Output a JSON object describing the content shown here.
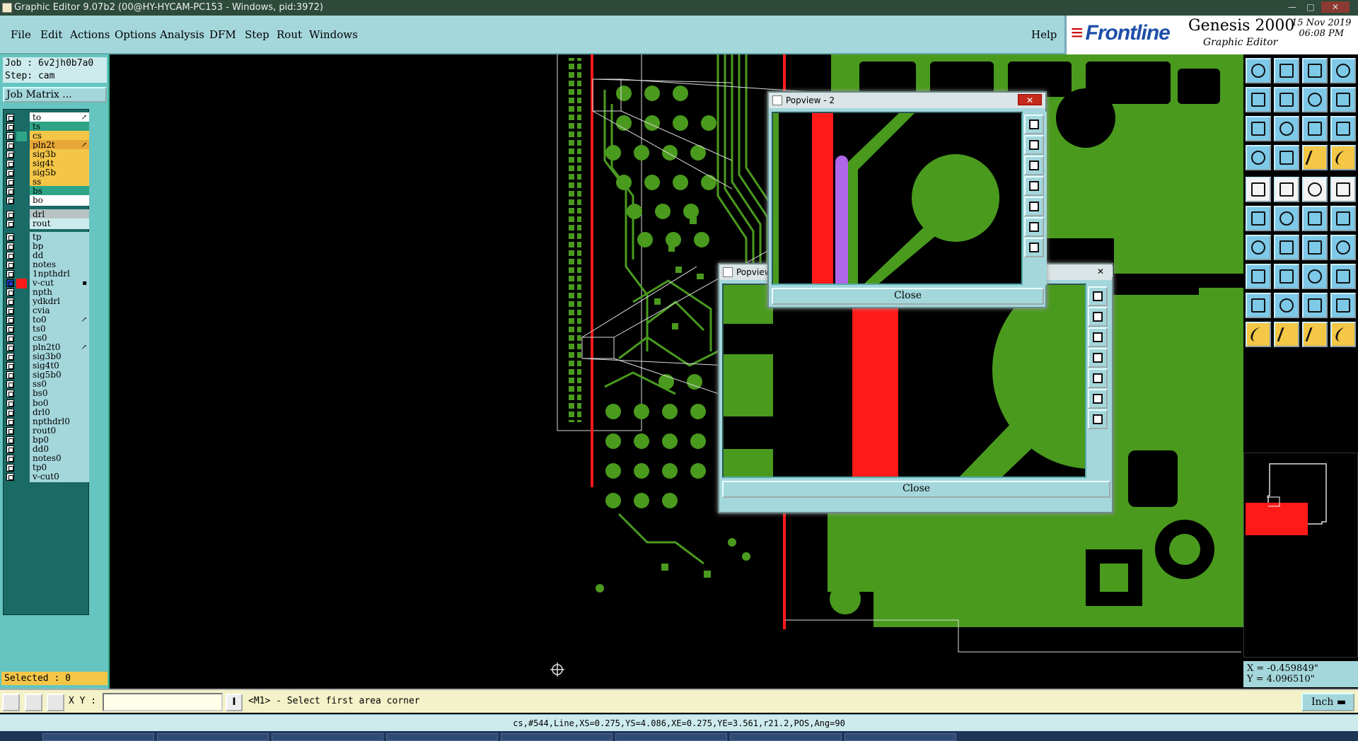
{
  "window": {
    "title": "Graphic Editor 9.07b2 (00@HY-HYCAM-PC153 - Windows, pid:3972)"
  },
  "menu": {
    "items": [
      "File",
      "Edit",
      "Actions",
      "Options",
      "Analysis",
      "DFM",
      "Step",
      "Rout",
      "Windows"
    ],
    "help": "Help"
  },
  "brand": {
    "logo": "Frontline",
    "product": "Genesis 2000",
    "subtitle": "Graphic Editor",
    "date": "15 Nov 2019",
    "time": "06:08 PM"
  },
  "job": {
    "job_line": "Job : 6v2jh0b7a0",
    "step_line": "Step: cam",
    "matrix_button": "Job Matrix ..."
  },
  "layers": [
    {
      "name": "to",
      "color": "#ffffff",
      "mark": "↗"
    },
    {
      "name": "ts",
      "color": "#2ea586",
      "mark": ""
    },
    {
      "name": "cs",
      "color": "#f4c648",
      "mark": ""
    },
    {
      "name": "pln2t",
      "color": "#e8a838",
      "mark": "↗"
    },
    {
      "name": "sig3b",
      "color": "#f4c648",
      "mark": ""
    },
    {
      "name": "sig4t",
      "color": "#f4c648",
      "mark": ""
    },
    {
      "name": "sig5b",
      "color": "#f4c648",
      "mark": ""
    },
    {
      "name": "ss",
      "color": "#f4c648",
      "mark": ""
    },
    {
      "name": "bs",
      "color": "#2ea586",
      "mark": ""
    },
    {
      "name": "bo",
      "color": "#ffffff",
      "mark": ""
    },
    {
      "name": "drl",
      "color": "#b7c4c4",
      "mark": ""
    },
    {
      "name": "rout",
      "color": "#cdebed",
      "mark": ""
    },
    {
      "name": "tp",
      "color": "#a4d7dc",
      "mark": ""
    },
    {
      "name": "bp",
      "color": "#a4d7dc",
      "mark": ""
    },
    {
      "name": "dd",
      "color": "#a4d7dc",
      "mark": ""
    },
    {
      "name": "notes",
      "color": "#a4d7dc",
      "mark": ""
    },
    {
      "name": "1npthdrl",
      "color": "#a4d7dc",
      "mark": ""
    },
    {
      "name": "v-cut",
      "color": "#a4d7dc",
      "mark": "▪"
    },
    {
      "name": "npth",
      "color": "#a4d7dc",
      "mark": ""
    },
    {
      "name": "ydkdrl",
      "color": "#a4d7dc",
      "mark": ""
    },
    {
      "name": "cvia",
      "color": "#a4d7dc",
      "mark": ""
    },
    {
      "name": "to0",
      "color": "#a4d7dc",
      "mark": "↗"
    },
    {
      "name": "ts0",
      "color": "#a4d7dc",
      "mark": ""
    },
    {
      "name": "cs0",
      "color": "#a4d7dc",
      "mark": ""
    },
    {
      "name": "pln2t0",
      "color": "#a4d7dc",
      "mark": "↗"
    },
    {
      "name": "sig3b0",
      "color": "#a4d7dc",
      "mark": ""
    },
    {
      "name": "sig4t0",
      "color": "#a4d7dc",
      "mark": ""
    },
    {
      "name": "sig5b0",
      "color": "#a4d7dc",
      "mark": ""
    },
    {
      "name": "ss0",
      "color": "#a4d7dc",
      "mark": ""
    },
    {
      "name": "bs0",
      "color": "#a4d7dc",
      "mark": ""
    },
    {
      "name": "bo0",
      "color": "#a4d7dc",
      "mark": ""
    },
    {
      "name": "drl0",
      "color": "#a4d7dc",
      "mark": ""
    },
    {
      "name": "npthdrl0",
      "color": "#a4d7dc",
      "mark": ""
    },
    {
      "name": "rout0",
      "color": "#a4d7dc",
      "mark": ""
    },
    {
      "name": "bp0",
      "color": "#a4d7dc",
      "mark": ""
    },
    {
      "name": "dd0",
      "color": "#a4d7dc",
      "mark": ""
    },
    {
      "name": "notes0",
      "color": "#a4d7dc",
      "mark": ""
    },
    {
      "name": "tp0",
      "color": "#a4d7dc",
      "mark": ""
    },
    {
      "name": "v-cut0",
      "color": "#a4d7dc",
      "mark": ""
    }
  ],
  "selected_text": "Selected : 0",
  "popviews": [
    {
      "title": "Popview - 2",
      "close_label": "Close"
    },
    {
      "title": "Popview",
      "close_label": "Close"
    }
  ],
  "command": {
    "xy_label": "X Y :",
    "xy_value": "",
    "prompt": "<M1> - Select first area corner",
    "units": "Inch"
  },
  "coordinates": {
    "x": "X = -0.459849\"",
    "y": "Y = 4.096510\""
  },
  "status": "cs,#544,Line,XS=0.275,YS=4.086,XE=0.275,YE=3.561,r21.2,POS,Ang=90",
  "colors": {
    "copper": "#4a9a1e",
    "vcut": "#ff1a1a",
    "highlight": "#b066e8",
    "background": "#000000",
    "panel": "#a4d7dc"
  }
}
